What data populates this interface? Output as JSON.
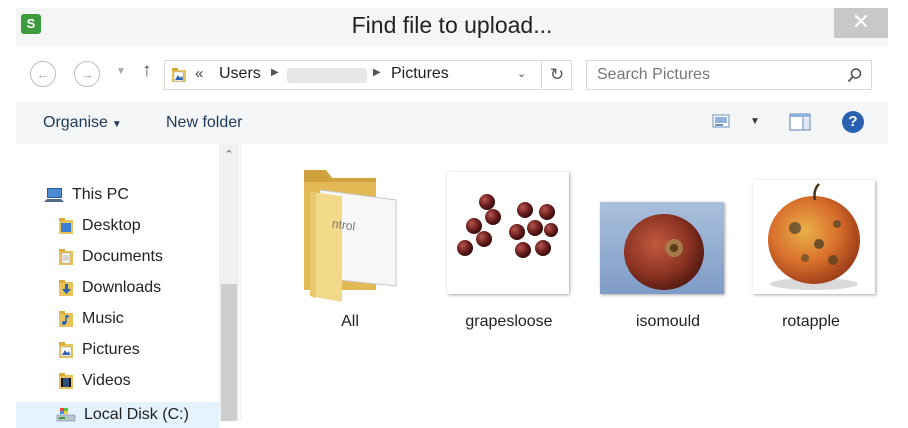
{
  "window": {
    "title": "Find file to upload...",
    "close_label": "✕"
  },
  "nav": {
    "back_icon": "back-arrow-icon",
    "forward_icon": "forward-arrow-icon",
    "up_icon": "up-arrow-icon",
    "address": {
      "chevron": "«",
      "crumbs": [
        "Users",
        "Pictures"
      ]
    },
    "search_placeholder": "Search Pictures"
  },
  "toolbar": {
    "organise_label": "Organise",
    "new_folder_label": "New folder"
  },
  "sidebar": {
    "items": [
      {
        "label": "This PC",
        "icon": "computer-icon"
      },
      {
        "label": "Desktop",
        "icon": "desktop-folder-icon"
      },
      {
        "label": "Documents",
        "icon": "documents-folder-icon"
      },
      {
        "label": "Downloads",
        "icon": "downloads-folder-icon"
      },
      {
        "label": "Music",
        "icon": "music-folder-icon"
      },
      {
        "label": "Pictures",
        "icon": "pictures-folder-icon"
      },
      {
        "label": "Videos",
        "icon": "videos-folder-icon"
      },
      {
        "label": "Local Disk (C:)",
        "icon": "drive-icon"
      }
    ]
  },
  "files": [
    {
      "name": "All",
      "type": "folder",
      "folder_paper_text": "ntrol"
    },
    {
      "name": "grapesloose",
      "type": "image"
    },
    {
      "name": "isomould",
      "type": "image"
    },
    {
      "name": "rotapple",
      "type": "image"
    }
  ],
  "colors": {
    "title_bar": "#f5f5f5",
    "toolbar": "#f5f6f7",
    "link_text": "#1e395b",
    "selected": "#e5f3ff",
    "help": "#2a62b3"
  }
}
